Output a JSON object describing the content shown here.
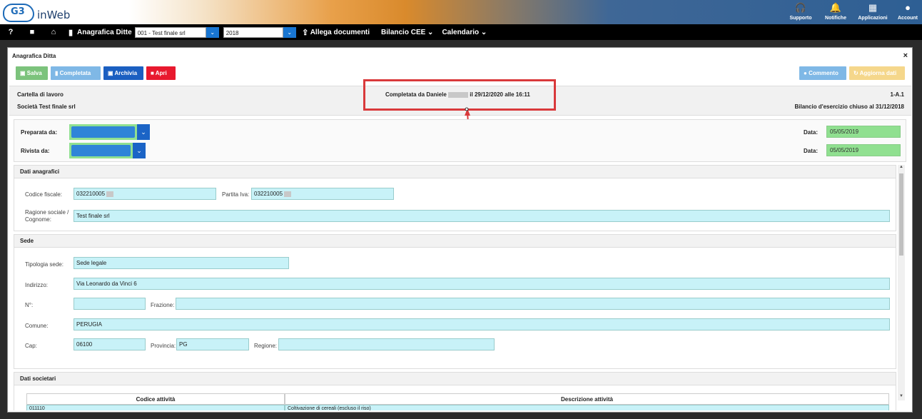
{
  "header": {
    "logo_mark": "G3",
    "app_name": "inWeb",
    "icons": [
      {
        "name": "support-icon",
        "glyph": "🎧",
        "label": "Supporto"
      },
      {
        "name": "bell-icon",
        "glyph": "🔔",
        "label": "Notifiche"
      },
      {
        "name": "apps-grid-icon",
        "glyph": "▦",
        "label": "Applicazioni"
      },
      {
        "name": "account-icon",
        "glyph": "●",
        "label": "Account"
      }
    ]
  },
  "nav": {
    "help_glyph": "?",
    "video_glyph": "■",
    "home_glyph": "⌂",
    "building_glyph": "▮",
    "anagrafica_label": "Anagrafica Ditte",
    "company_select": "001 - Test finale srl",
    "year_select": "2018",
    "upload_glyph": "⇪",
    "allega_label": "Allega documenti",
    "bilancio_label": "Bilancio CEE ⌄",
    "calendario_label": "Calendario ⌄",
    "dropdown_glyph": "⌄"
  },
  "modal": {
    "title": "Anagrafica Ditta",
    "close_glyph": "×",
    "buttons": {
      "salva": "Salva",
      "completata": "Completata",
      "archivia": "Archivia",
      "apri": "Apri",
      "commento": "Commento",
      "aggiorna": "Aggiorna dati"
    },
    "info": {
      "cartella": "Cartella di lavoro",
      "societa": "Società Test finale srl",
      "completata_prefix": "Completata da Daniele",
      "completata_suffix": "il 29/12/2020 alle 16:11",
      "code": "1-A.1",
      "bilancio": "Bilancio d'esercizio chiuso al 31/12/2018"
    },
    "prep": {
      "preparata_label": "Preparata da:",
      "rivista_label": "Rivista da:",
      "data_label": "Data:",
      "data1": "05/05/2019",
      "data2": "05/05/2019"
    },
    "dati_anagrafici": {
      "title": "Dati anagrafici",
      "codice_fiscale_label": "Codice fiscale:",
      "codice_fiscale": "032210005",
      "partita_iva_label": "Partita Iva:",
      "partita_iva": "032210005",
      "ragione_label_1": "Ragione sociale /",
      "ragione_label_2": "Cognome:",
      "ragione": "Test finale srl"
    },
    "sede": {
      "title": "Sede",
      "tipologia_label": "Tipologia sede:",
      "tipologia": "Sede legale",
      "indirizzo_label": "Indirizzo:",
      "indirizzo": "Via Leonardo da Vinci 6",
      "numero_label": "N°:",
      "numero": "",
      "frazione_label": "Frazione:",
      "frazione": "",
      "comune_label": "Comune:",
      "comune": "PERUGIA",
      "cap_label": "Cap:",
      "cap": "06100",
      "provincia_label": "Provincia:",
      "provincia": "PG",
      "regione_label": "Regione:",
      "regione": ""
    },
    "dati_societari": {
      "title": "Dati societari",
      "columns": [
        "Codice attività",
        "Descrizione attività"
      ],
      "rows": [
        [
          "011110",
          "Coltivazione di cereali (escluso il riso)"
        ]
      ]
    }
  }
}
